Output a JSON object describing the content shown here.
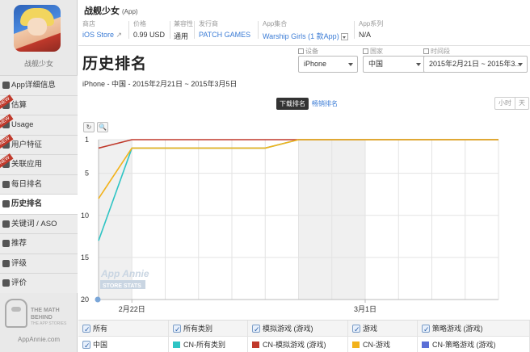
{
  "app": {
    "side_name": "战舰少女",
    "title": "战舰少女",
    "tag": "(App)"
  },
  "meta": {
    "store_label": "商店",
    "store_value": "iOS Store",
    "price_label": "价格",
    "price_value": "0.99 USD",
    "compat_label": "兼容性",
    "compat_value": "通用",
    "publisher_label": "发行商",
    "publisher_value": "PATCH GAMES",
    "collection_label": "App集合",
    "collection_value": "Warship Girls (1 款App)",
    "series_label": "App系列",
    "series_value": "N/A"
  },
  "sidebar": {
    "items": [
      {
        "label": "App详细信息",
        "icon": "info-icon",
        "ribbon": ""
      },
      {
        "label": "估算",
        "icon": "chart-icon",
        "ribbon": "NEW"
      },
      {
        "label": "Usage",
        "icon": "usage-icon",
        "ribbon": "NEW"
      },
      {
        "label": "用户特征",
        "icon": "users-icon",
        "ribbon": "NEW"
      },
      {
        "label": "关联应用",
        "icon": "link-icon",
        "ribbon": "NEW"
      },
      {
        "label": "每日排名",
        "icon": "calendar-icon",
        "ribbon": ""
      },
      {
        "label": "历史排名",
        "icon": "history-icon",
        "ribbon": ""
      },
      {
        "label": "关键词 / ASO",
        "icon": "key-icon",
        "ribbon": ""
      },
      {
        "label": "推荐",
        "icon": "featured-icon",
        "ribbon": ""
      },
      {
        "label": "评级",
        "icon": "star-icon",
        "ribbon": ""
      },
      {
        "label": "评价",
        "icon": "comment-icon",
        "ribbon": ""
      }
    ],
    "active_index": 6,
    "brand_text": "THE MATH BEHIND",
    "brand_sub": "THE APP STORIES",
    "brand_url": "AppAnnie.com"
  },
  "page": {
    "title": "历史排名",
    "subtitle": "iPhone - 中国 - 2015年2月21日 ~ 2015年3月5日"
  },
  "filters": {
    "device_label": "设备",
    "device_value": "iPhone",
    "country_label": "国家",
    "country_value": "中国",
    "period_label": "时间段",
    "period_value": "2015年2月21日 ~ 2015年3..."
  },
  "toggle": {
    "downloads": "下载排名",
    "grossing": "畅销排名"
  },
  "time_buttons": [
    "小时",
    "天"
  ],
  "tools": {
    "reset": "↻",
    "zoom": "🔍"
  },
  "watermark": {
    "line1": "App Annie",
    "line2": "STORE STATS"
  },
  "legend": {
    "row1": [
      "所有",
      "所有类别",
      "模拟游戏 (游戏)",
      "游戏",
      "策略游戏 (游戏)"
    ],
    "row2": [
      "中国",
      "CN-所有类别",
      "CN-模拟游戏 (游戏)",
      "CN-游戏",
      "CN-策略游戏 (游戏)"
    ],
    "colors": [
      "#2ec4c4",
      "#c0392b",
      "#f2b21b",
      "#5b6fd6"
    ]
  },
  "chart_data": {
    "type": "line",
    "y_reversed": true,
    "ylim": [
      1,
      20
    ],
    "yticks": [
      1,
      5,
      10,
      15,
      20
    ],
    "x_tick_labels": [
      "2月22日",
      "3月1日"
    ],
    "x": [
      "2月21日",
      "2月22日",
      "2月23日",
      "2月24日",
      "2月25日",
      "2月26日",
      "2月27日",
      "2月28日",
      "3月1日",
      "3月2日",
      "3月3日",
      "3月4日",
      "3月5日"
    ],
    "series": [
      {
        "name": "CN-所有类别",
        "color": "#2ec4c4",
        "values": [
          13,
          2,
          2,
          2,
          2,
          2,
          1,
          1,
          1,
          1,
          1,
          1,
          1
        ]
      },
      {
        "name": "CN-模拟游戏 (游戏)",
        "color": "#c0392b",
        "values": [
          2,
          1,
          1,
          1,
          1,
          1,
          1,
          1,
          1,
          1,
          1,
          1,
          1
        ]
      },
      {
        "name": "CN-游戏",
        "color": "#f2b21b",
        "values": [
          8,
          2,
          2,
          2,
          2,
          2,
          1,
          1,
          1,
          1,
          1,
          1,
          1
        ]
      }
    ]
  }
}
